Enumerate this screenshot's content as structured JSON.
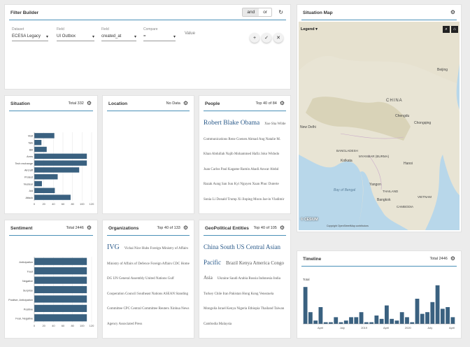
{
  "filter_builder": {
    "title": "Filter Builder",
    "mode_and": "and",
    "mode_or": "or",
    "fields": [
      {
        "label": "Dataset",
        "value": "ECESA Legacy"
      },
      {
        "label": "Field",
        "value": "UI Outbox"
      },
      {
        "label": "Field",
        "value": "created_at"
      },
      {
        "label": "Compare",
        "value": "="
      }
    ],
    "value_label": "Value"
  },
  "situation": {
    "title": "Situation",
    "total": "Total 332",
    "chart_data": {
      "type": "bar",
      "orientation": "horizontal",
      "categories": [
        "Visit",
        "Talk",
        "Bill",
        "Arms",
        "Tech exchange",
        "Aircraft",
        "Protest",
        "Nuclear",
        "Aid",
        "Attack"
      ],
      "values": [
        42,
        15,
        26,
        110,
        110,
        94,
        49,
        16,
        43,
        76
      ],
      "xlim": [
        0,
        120
      ],
      "ticks": [
        0,
        20,
        40,
        60,
        80,
        100,
        120
      ]
    }
  },
  "location": {
    "title": "Location",
    "total": "No Data"
  },
  "people": {
    "title": "People",
    "total": "Top 40 of 84",
    "big": "Robert Blake Obama",
    "rest": "Xue Sha Wilde Communications Rene Coenen Ahmad Ang Natalie M. Khan Abdullah Najib Mohammed Hafiz Joko Widodo Juan Carlos Paul Kagame Ramin Ahadi Anwar Abdul Razak Aung San Suu Kyi Nguyen Xuan Phuc Duterte Sonia Li Donald Trump Xi Jinping Moon Jae-in Vladimir Putin Dalai Lama Mohammed bin Salman"
  },
  "situation_map": {
    "title": "Situation Map",
    "legend": "Legend",
    "labels": {
      "china": "CHINA",
      "beijing": "Beijing",
      "new_delhi": "New Delhi",
      "bangladesh": "BANGLADESH",
      "myanmar": "MYANMAR (BURMA)",
      "kolkata": "Kolkata",
      "chengdu": "Chengdu",
      "chongqing": "Chongqing",
      "bay_of_bengal": "Bay of Bengal",
      "thailand": "THAILAND",
      "bangkok": "Bangkok",
      "cambodia": "CAMBODIA",
      "yangon": "Yangon",
      "hanoi": "Hanoi",
      "vietnam": "VIETNAM",
      "attribution": "© CESIUM",
      "copyright": "Copyright OpenStreetMap contributors"
    }
  },
  "sentiment": {
    "title": "Sentiment",
    "total": "Total 2446",
    "chart_data": {
      "type": "bar",
      "orientation": "horizontal",
      "categories": [
        "Anticipation",
        "Trust",
        "Negative",
        "Surprise",
        "Positive, Anticipation",
        "Positive",
        "Fear, Negative"
      ],
      "values": [
        110,
        110,
        110,
        110,
        110,
        110,
        110
      ],
      "xlim": [
        0,
        120
      ],
      "ticks": [
        0,
        20,
        40,
        60,
        80,
        100,
        120
      ]
    }
  },
  "organizations": {
    "title": "Organizations",
    "total": "Top 40 of 133",
    "big": "IVG",
    "rest": "Vichai Nice Hubs Foreign Ministry of Affairs Ministry of Affairs of Defence Foreign Affairs CDC Home DG UN General Assembly United Nations Gulf Cooperation Council Southeast Nations ASEAN Standing Committee CPC Central Committee Reuters Xinhua News Agency Associated Press"
  },
  "geopolitical": {
    "title": "GeoPolitical Entities",
    "total": "Top 40 of 105",
    "big": "China South US Central Asian Pacific",
    "mid": "Brazil Kenya America Congo Asia",
    "rest": "Ukraine Saudi Arabia Russia Indonesia India Turkey Chile Iran Pakistan Hong Kong Venezuela Mongolia Israel Kenya Nigeria Ethiopia Thailand Taiwan Cambodia Malaysia"
  },
  "timeline": {
    "title": "Timeline",
    "total": "Total 2446",
    "ylabel": "Total",
    "xlabels": [
      "April",
      "July",
      "2019",
      "April",
      "2020",
      "July",
      "April"
    ],
    "chart_data": {
      "type": "bar",
      "values": [
        44,
        14,
        4,
        20,
        2,
        2,
        8,
        2,
        4,
        8,
        8,
        14,
        2,
        2,
        10,
        6,
        22,
        6,
        4,
        14,
        8,
        2,
        30,
        12,
        14,
        26,
        46,
        18,
        20,
        8
      ],
      "ylim": [
        0,
        50
      ]
    }
  }
}
